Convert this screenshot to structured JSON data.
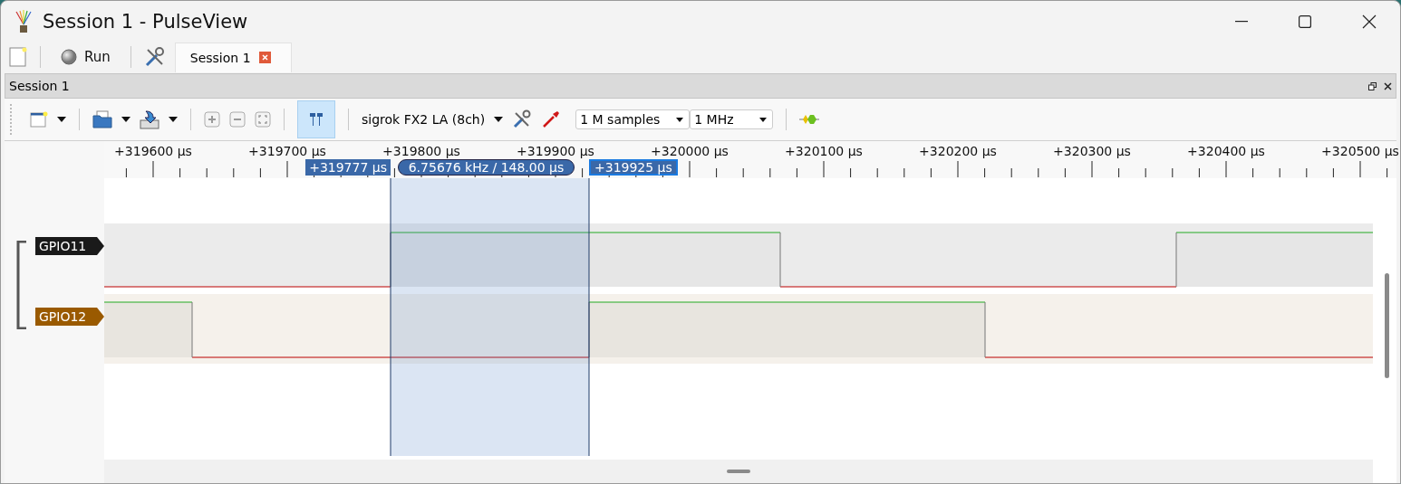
{
  "window": {
    "title": "Session 1 - PulseView"
  },
  "main_toolbar": {
    "run_label": "Run",
    "tabs": [
      {
        "label": "Session 1",
        "selected": true
      }
    ]
  },
  "session": {
    "title": "Session 1",
    "toolbar": {
      "cursors_on": true,
      "device": "sigrok FX2 LA (8ch)",
      "samples": "1 M samples",
      "rate": "1 MHz"
    },
    "ruler": [
      "+319600 µs",
      "+319700 µs",
      "+319800 µs",
      "+319900 µs",
      "+320000 µs",
      "+320100 µs",
      "+320200 µs",
      "+320300 µs",
      "+320400 µs",
      "+320500 µs"
    ],
    "cursors": [
      {
        "label": "+319777 µs",
        "selected": false
      },
      {
        "label": "+319925 µs",
        "selected": true
      }
    ],
    "measurement": "6.75676 kHz / 148.00 µs",
    "channels": [
      {
        "name": "GPIO11",
        "color": "#1a1a1a"
      },
      {
        "name": "GPIO12",
        "color": "#9a5a00"
      }
    ]
  }
}
